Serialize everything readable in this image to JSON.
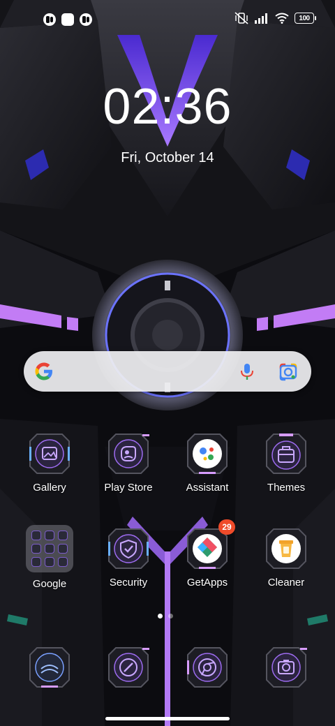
{
  "status_bar": {
    "notification_icons": [
      "app-notification-icon",
      "square-notification-icon",
      "app-notification-icon"
    ],
    "battery_level": "100"
  },
  "lock": {
    "time": "02:36",
    "date": "Fri, October 14"
  },
  "search": {
    "logo": "google-g-icon",
    "mic": "mic-icon",
    "lens": "lens-icon"
  },
  "apps_row1": [
    {
      "label": "Gallery",
      "icon": "gallery-icon"
    },
    {
      "label": "Play Store",
      "icon": "play-store-icon"
    },
    {
      "label": "Assistant",
      "icon": "assistant-icon"
    },
    {
      "label": "Themes",
      "icon": "themes-icon"
    }
  ],
  "apps_row2": [
    {
      "label": "Google",
      "icon": "folder-icon"
    },
    {
      "label": "Security",
      "icon": "security-icon"
    },
    {
      "label": "GetApps",
      "icon": "getapps-icon",
      "badge": "29"
    },
    {
      "label": "Cleaner",
      "icon": "cleaner-icon"
    }
  ],
  "dock": [
    {
      "icon": "phone-icon"
    },
    {
      "icon": "messages-icon"
    },
    {
      "icon": "chrome-icon"
    },
    {
      "icon": "camera-icon"
    }
  ],
  "page_indicator": {
    "pages": 2,
    "current": 1
  },
  "colors": {
    "accent": "#a96bf0",
    "neon": "#c48cff",
    "badge": "#ef4b2a"
  }
}
